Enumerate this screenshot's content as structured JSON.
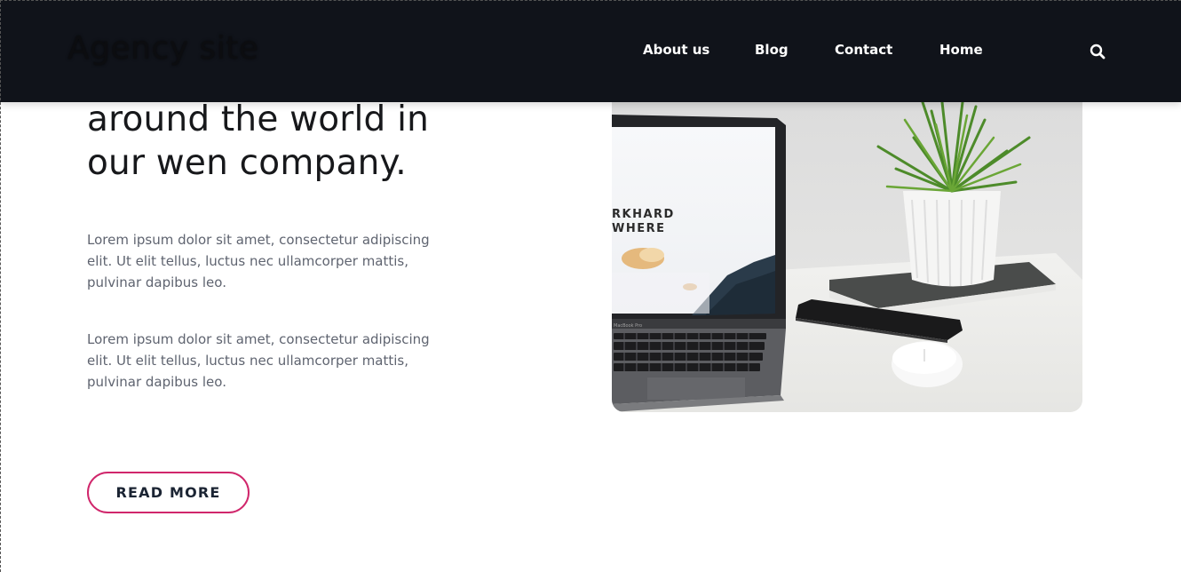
{
  "header": {
    "logo": "Agency site",
    "nav": [
      {
        "label": "About us"
      },
      {
        "label": "Blog"
      },
      {
        "label": "Contact"
      },
      {
        "label": "Home"
      }
    ],
    "search_icon": "search-icon"
  },
  "hero": {
    "title_lines": [
      "around the world in",
      "our wen company."
    ],
    "paragraph_1": [
      "Lorem ipsum dolor sit amet, consectetur adipiscing",
      "elit. Ut elit tellus, luctus nec ullamcorper mattis,",
      "pulvinar dapibus leo."
    ],
    "paragraph_2": [
      "Lorem ipsum dolor sit amet, consectetur adipiscing",
      "elit. Ut elit tellus, luctus nec ullamcorper mattis,",
      "pulvinar dapibus leo."
    ],
    "button_label": "READ MORE",
    "image": {
      "screen_text_1": "RKHARD",
      "screen_text_2": "WHERE",
      "laptop_label": "MacBook Pro"
    }
  },
  "colors": {
    "header_bg": "#10131a",
    "accent": "#d0266b",
    "heading": "#17181b",
    "body_text": "#5f6470"
  }
}
